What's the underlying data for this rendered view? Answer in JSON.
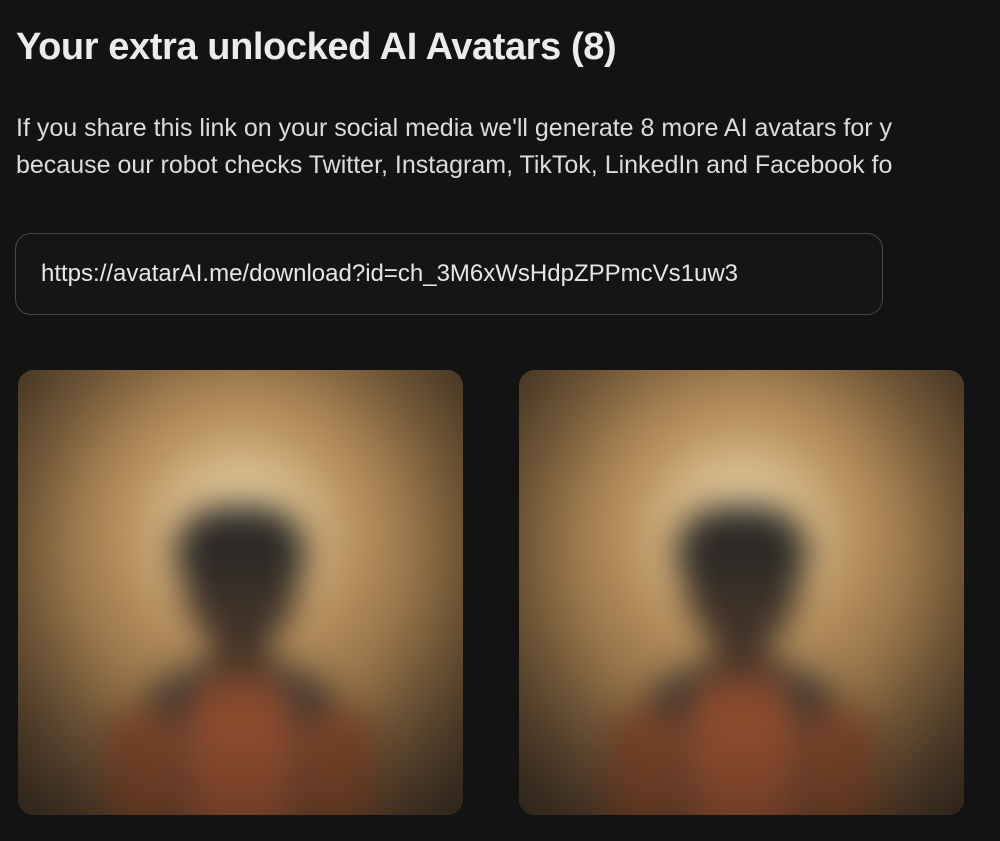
{
  "header": {
    "title": "Your extra unlocked AI Avatars (8)"
  },
  "description": {
    "line1": "If you share this link on your social media we'll generate 8 more AI avatars for y",
    "line2": "because our robot checks Twitter, Instagram, TikTok, LinkedIn and Facebook fo"
  },
  "share_link": {
    "url": "https://avatarAI.me/download?id=ch_3M6xWsHdpZPPmcVs1uw3"
  },
  "avatars": [
    {
      "name": "avatar-image-1",
      "blurred": true
    },
    {
      "name": "avatar-image-2",
      "blurred": true
    }
  ],
  "colors": {
    "background": "#131313",
    "text": "#e8e8e8",
    "input_border": "#474747"
  }
}
